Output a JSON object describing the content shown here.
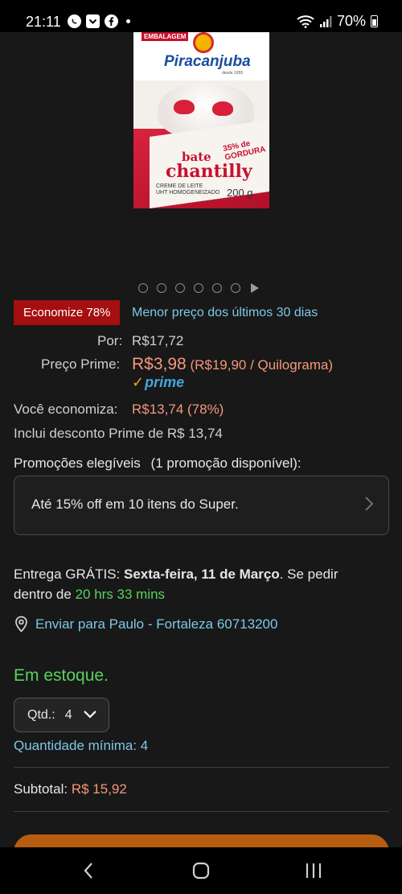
{
  "status_bar": {
    "time": "21:11",
    "battery": "70%",
    "left_icons": [
      "whatsapp-icon",
      "pocket-icon",
      "facebook-icon"
    ],
    "right_icons": [
      "wifi-icon",
      "signal-icon",
      "battery-icon"
    ]
  },
  "product_image": {
    "brand": "Piracanjuba",
    "brand_sub": "desde 1955",
    "badge": "EMBALAGEM",
    "name_line1": "bate",
    "name_line2": "chantilly",
    "promo": "35% de GORDURA",
    "desc_line1": "CREME DE LEITE",
    "desc_line2": "UHT HOMOGENEIZADO",
    "weight": "200 g"
  },
  "gallery": {
    "dot_count": 6,
    "has_video": true
  },
  "deal": {
    "badge": "Economize 78%",
    "lowest_price_note": "Menor preço dos últimos 30 dias"
  },
  "pricing": {
    "list_label": "Por:",
    "list_price": "R$17,72",
    "prime_label": "Preço Prime:",
    "prime_price": "R$3,98",
    "unit_price": "(R$19,90 / Quilograma)",
    "prime_logo_check": "✓",
    "prime_logo_text": "prime",
    "savings_label": "Você economiza:",
    "savings_value": "R$13,74 (78%)",
    "prime_discount_note": "Inclui desconto Prime de R$ 13,74"
  },
  "promotions": {
    "label": "Promoções elegíveis",
    "count_note": "(1 promoção disponível):",
    "item": "Até 15% off em 10 itens do Super."
  },
  "delivery": {
    "prefix": "Entrega GRÁTIS: ",
    "date": "Sexta-feira, 11 de Março",
    "middle": ". Se pedir dentro de ",
    "countdown": "20 hrs 33 mins",
    "ship_to": "Enviar para Paulo - Fortaleza 60713200"
  },
  "availability": {
    "stock": "Em estoque.",
    "qty_label": "Qtd.:",
    "qty_value": "4",
    "min_qty": "Quantidade mínima: 4"
  },
  "subtotal": {
    "label": "Subtotal:",
    "value": "R$ 15,92"
  },
  "colors": {
    "accent_price": "#f6977a",
    "link": "#7cc8e6",
    "in_stock": "#58d25e",
    "deal_badge": "#a50f0f",
    "buy_button": "#b75d10"
  }
}
